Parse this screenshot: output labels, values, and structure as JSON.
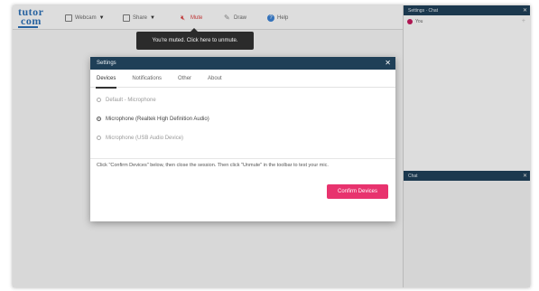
{
  "logo": {
    "line1": "tutor",
    "line2": "com"
  },
  "toolbar": {
    "webcam_label": "Webcam",
    "share_label": "Share",
    "mute_label": "Mute",
    "draw_label": "Draw",
    "help_label": "Help",
    "tooltip": "You're muted. Click here to unmute."
  },
  "right_panel": {
    "top_title": "Settings · Chat",
    "user_name": "You",
    "bottom_title": "Chat"
  },
  "modal": {
    "title": "Settings",
    "close_glyph": "✕",
    "tabs": [
      {
        "label": "Devices",
        "active": true
      },
      {
        "label": "Notifications",
        "active": false
      },
      {
        "label": "Other",
        "active": false
      },
      {
        "label": "About",
        "active": false
      }
    ],
    "microphones": [
      {
        "label": "Default - Microphone",
        "selected": false
      },
      {
        "label": "Microphone (Realtek High Definition Audio)",
        "selected": true
      },
      {
        "label": "Microphone (USB Audio Device)",
        "selected": false
      }
    ],
    "hint": "Click \"Confirm Devices\" below, then close the session. Then click \"Unmute\" in the toolbar to test your mic.",
    "confirm_label": "Confirm Devices"
  },
  "colors": {
    "header_navy": "#1f3f57",
    "confirm_pink": "#e8336e",
    "mute_red": "#d43838",
    "logo_blue": "#2d6fb3",
    "user_dot": "#c2185b"
  }
}
